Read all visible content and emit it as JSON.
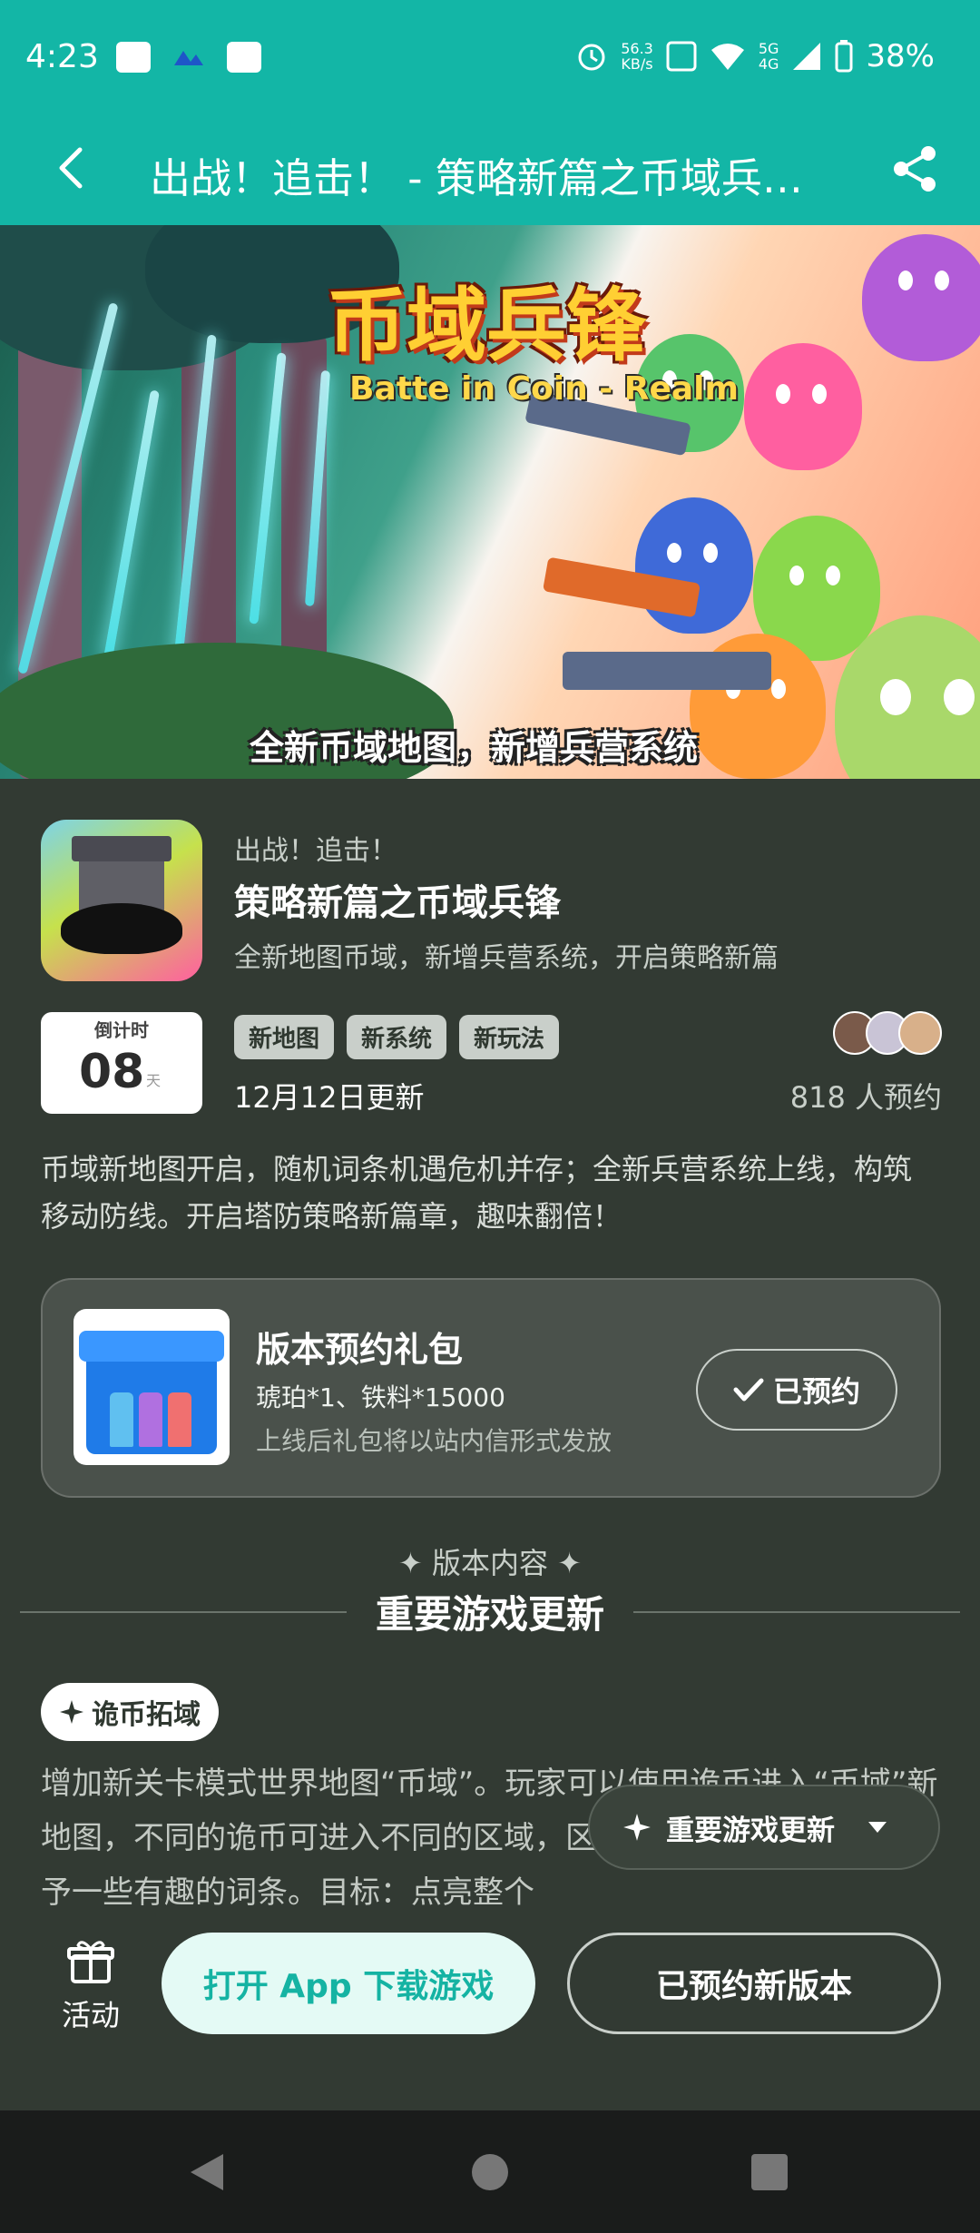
{
  "status_bar": {
    "time": "4:23",
    "net_speed_value": "56.3",
    "net_speed_unit": "KB/s",
    "network": "5G",
    "network2": "4G",
    "battery": "38%"
  },
  "header": {
    "title": "出战！追击！ - 策略新篇之币域兵…"
  },
  "banner": {
    "title": "币域兵锋",
    "subtitle": "Batte in Coin - Realm",
    "caption": "全新币域地图，新增兵营系统"
  },
  "game": {
    "subtitle": "出战！追击！",
    "title": "策略新篇之币域兵锋",
    "description": "全新地图币域，新增兵营系统，开启策略新篇",
    "countdown_label": "倒计时",
    "countdown_value": "08",
    "countdown_unit": "天",
    "tags": [
      "新地图",
      "新系统",
      "新玩法"
    ],
    "update_date": "12月12日更新",
    "reserve_count": "818 人预约",
    "intro": "币域新地图开启，随机词条机遇危机并存；全新兵营系统上线，构筑移动防线。开启塔防策略新篇章，趣味翻倍！"
  },
  "gift": {
    "title": "版本预约礼包",
    "items": "琥珀*1、铁料*15000",
    "note": "上线后礼包将以站内信形式发放",
    "button_label": "已预约"
  },
  "version": {
    "label": "✦ 版本内容 ✦",
    "title": "重要游戏更新",
    "section_label": "诡币拓域",
    "section_text": "增加新关卡模式世界地图“币域”。玩家可以使用诡币进入“币域”新地图，不同的诡币可进入不同的区域，区域根据稀有度会被随机赋予一些有趣的词条。目标：点亮整个",
    "float_label": "重要游戏更新"
  },
  "bottom": {
    "activity_label": "活动",
    "open_app_label": "打开 App 下载游戏",
    "reserved_new_label": "已预约新版本"
  },
  "colors": {
    "teal": "#13b6a6",
    "background": "#323a33",
    "navbar": "#1a1c1b"
  }
}
